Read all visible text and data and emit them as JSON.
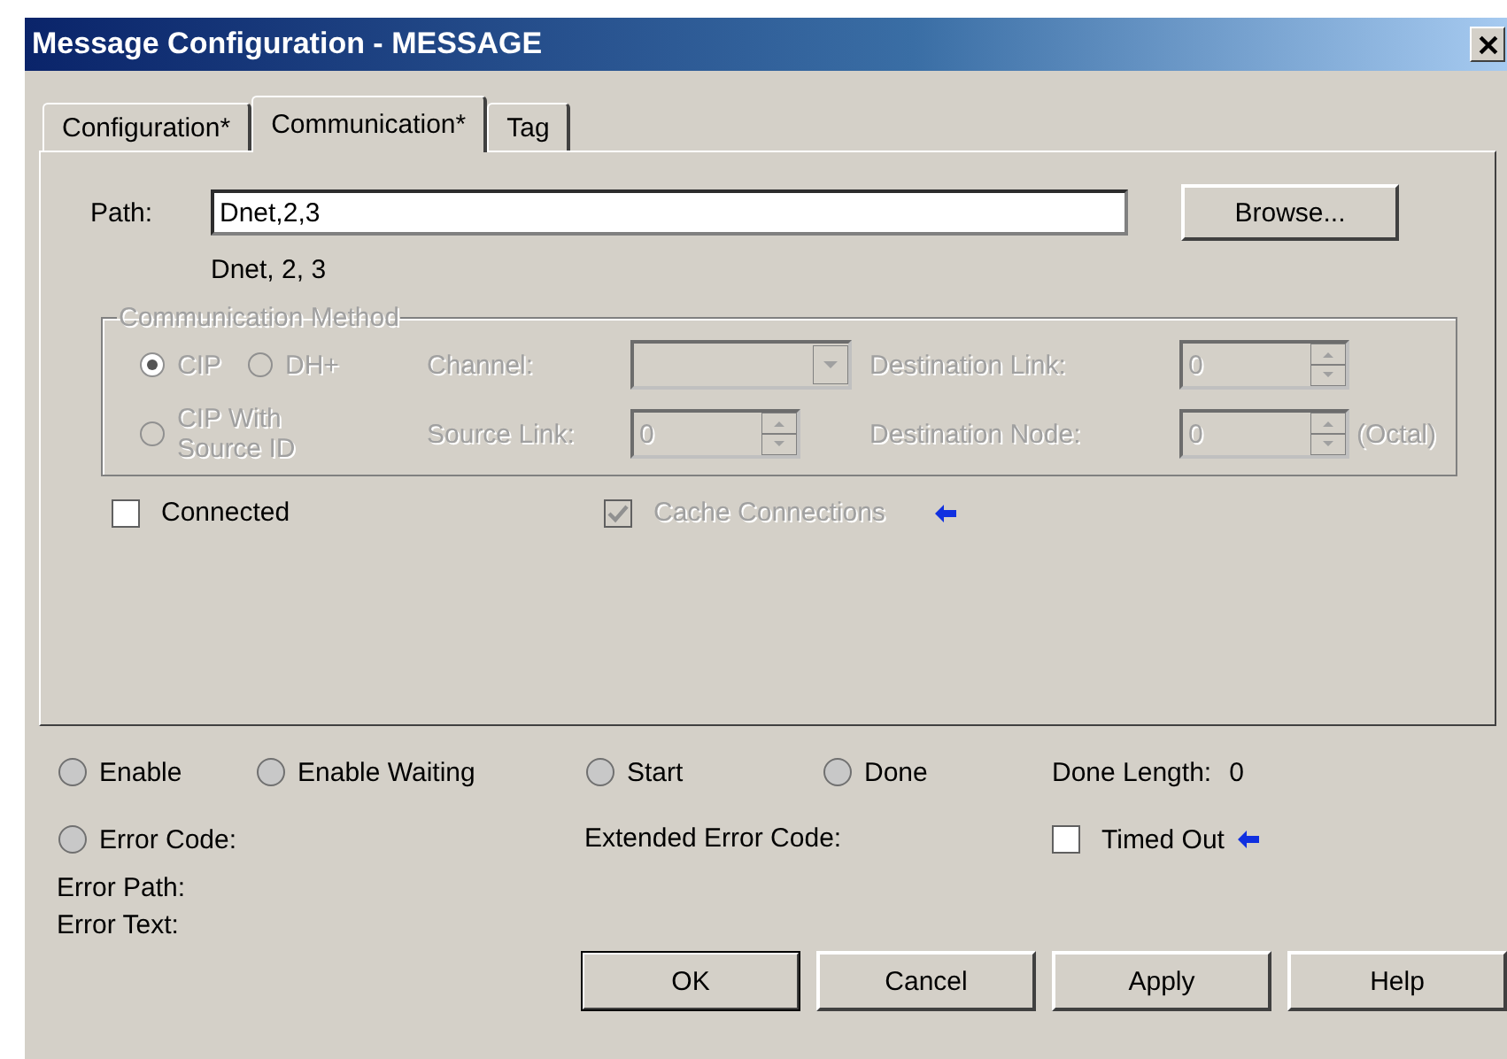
{
  "window": {
    "title": "Message Configuration - MESSAGE"
  },
  "tabs": [
    {
      "label": "Configuration*",
      "selected": false
    },
    {
      "label": "Communication*",
      "selected": true
    },
    {
      "label": "Tag",
      "selected": false
    }
  ],
  "path": {
    "label": "Path:",
    "value": "Dnet,2,3",
    "resolved": "Dnet, 2, 3",
    "browse": "Browse..."
  },
  "communication_method": {
    "title": "Communication Method",
    "disabled": true,
    "methods": [
      {
        "label": "CIP",
        "selected": true
      },
      {
        "label": "DH+",
        "selected": false
      },
      {
        "label": "CIP With Source ID",
        "selected": false
      }
    ],
    "channel": {
      "label": "Channel:"
    },
    "destination_link": {
      "label": "Destination Link:",
      "value": "0"
    },
    "source_link": {
      "label": "Source Link:",
      "value": "0"
    },
    "destination_node": {
      "label": "Destination Node:",
      "value": "0",
      "suffix": "(Octal)"
    }
  },
  "options": [
    {
      "label": "Connected",
      "checked": false,
      "disabled": false
    },
    {
      "label": "Cache Connections",
      "checked": true,
      "disabled": true
    }
  ],
  "status": [
    {
      "label": "Enable",
      "lit": false
    },
    {
      "label": "Enable Waiting",
      "lit": false
    },
    {
      "label": "Start",
      "lit": false
    },
    {
      "label": "Done",
      "lit": false
    }
  ],
  "done_length": {
    "label": "Done Length:",
    "value": "0"
  },
  "error_code": {
    "label": "Error Code:",
    "lit": false
  },
  "extended_error_code": {
    "label": "Extended Error Code:"
  },
  "timed_out": {
    "label": "Timed Out",
    "checked": false
  },
  "error_path": {
    "label": "Error Path:"
  },
  "error_text": {
    "label": "Error Text:"
  },
  "buttons": [
    {
      "label": "OK",
      "default": true
    },
    {
      "label": "Cancel",
      "default": false
    },
    {
      "label": "Apply",
      "default": false
    },
    {
      "label": "Help",
      "default": false
    }
  ]
}
